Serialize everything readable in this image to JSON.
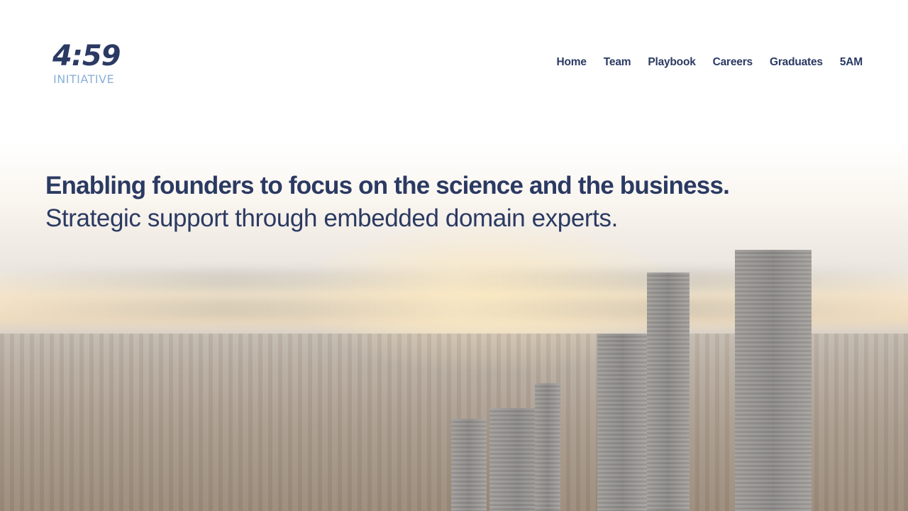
{
  "header": {
    "logo": {
      "number": "4:59",
      "subtitle": "INITIATIVE"
    },
    "nav": [
      {
        "label": "Home"
      },
      {
        "label": "Team"
      },
      {
        "label": "Playbook"
      },
      {
        "label": "Careers"
      },
      {
        "label": "Graduates"
      },
      {
        "label": "5AM"
      }
    ]
  },
  "hero": {
    "title": "Enabling founders to focus on the science and the business.",
    "subtitle": "Strategic support through embedded domain experts.",
    "background_image": "city-skyline-at-sunrise"
  },
  "colors": {
    "brand_navy": "#2b3a63",
    "brand_light_blue": "#8bb0d6",
    "brand_gold": "#e8b339"
  }
}
